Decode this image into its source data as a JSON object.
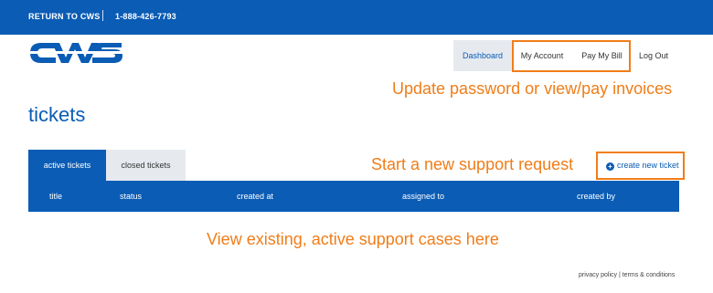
{
  "topbar": {
    "return_label": "RETURN TO CWS",
    "phone": "1-888-426-7793"
  },
  "logo": {
    "text": "CWS",
    "color": "#0a5cb5"
  },
  "nav": {
    "dashboard": "Dashboard",
    "my_account": "My Account",
    "pay_bill": "Pay My Bill",
    "logout": "Log Out"
  },
  "annotations": {
    "account_hint": "Update password or view/pay invoices",
    "new_request_hint": "Start a new support request",
    "existing_hint": "View existing, active support cases here"
  },
  "page": {
    "title": "tickets"
  },
  "tabs": {
    "active": "active tickets",
    "closed": "closed tickets"
  },
  "create_button": {
    "icon": "plus-circle-icon",
    "label": "create new ticket"
  },
  "table": {
    "columns": [
      "title",
      "status",
      "created at",
      "assigned to",
      "created by"
    ]
  },
  "footer": {
    "privacy": "privacy policy",
    "divider": " | ",
    "terms": "terms & conditions"
  },
  "colors": {
    "brand_blue": "#0a5cb5",
    "highlight_orange": "#f07d19",
    "tab_gray": "#e6eaef"
  }
}
